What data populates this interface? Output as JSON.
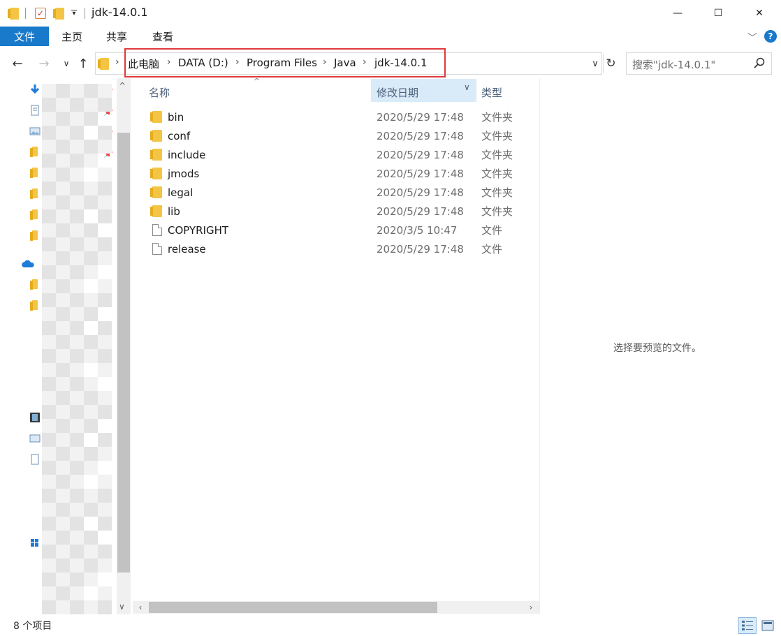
{
  "window": {
    "title": "jdk-14.0.1",
    "quick_access_dropdown": "▾",
    "minimize": "—",
    "maximize": "☐",
    "close": "✕"
  },
  "ribbon": {
    "tabs": [
      "文件",
      "主页",
      "共享",
      "查看"
    ],
    "expand_chevron": "﹀",
    "help": "?"
  },
  "nav": {
    "back": "←",
    "forward": "→",
    "recent": "∨",
    "up": "↑"
  },
  "address": {
    "breadcrumbs": [
      "此电脑",
      "DATA (D:)",
      "Program Files",
      "Java",
      "jdk-14.0.1"
    ],
    "separator": "›",
    "dropdown": "∨",
    "refresh": "↻"
  },
  "search": {
    "placeholder": "搜索\"jdk-14.0.1\""
  },
  "columns": {
    "name": "名称",
    "date_modified": "修改日期",
    "type": "类型",
    "sort_caret": "^",
    "menu_caret": "∨"
  },
  "files": [
    {
      "name": "bin",
      "date": "2020/5/29 17:48",
      "type": "文件夹",
      "kind": "folder"
    },
    {
      "name": "conf",
      "date": "2020/5/29 17:48",
      "type": "文件夹",
      "kind": "folder"
    },
    {
      "name": "include",
      "date": "2020/5/29 17:48",
      "type": "文件夹",
      "kind": "folder"
    },
    {
      "name": "jmods",
      "date": "2020/5/29 17:48",
      "type": "文件夹",
      "kind": "folder"
    },
    {
      "name": "legal",
      "date": "2020/5/29 17:48",
      "type": "文件夹",
      "kind": "folder"
    },
    {
      "name": "lib",
      "date": "2020/5/29 17:48",
      "type": "文件夹",
      "kind": "folder"
    },
    {
      "name": "COPYRIGHT",
      "date": "2020/3/5 10:47",
      "type": "文件",
      "kind": "file"
    },
    {
      "name": "release",
      "date": "2020/5/29 17:48",
      "type": "文件",
      "kind": "file"
    }
  ],
  "navpane": {
    "partial_label": ":)",
    "scroll_up": "^",
    "scroll_down": "∨"
  },
  "hscroll": {
    "left": "‹",
    "right": "›"
  },
  "preview": {
    "message": "选择要预览的文件。"
  },
  "status": {
    "item_count": "8 个项目"
  },
  "colors": {
    "accent": "#1979ca",
    "highlight_border": "#e0393e",
    "folder": "#f4c544",
    "sorted_column": "#d9ebf9"
  }
}
